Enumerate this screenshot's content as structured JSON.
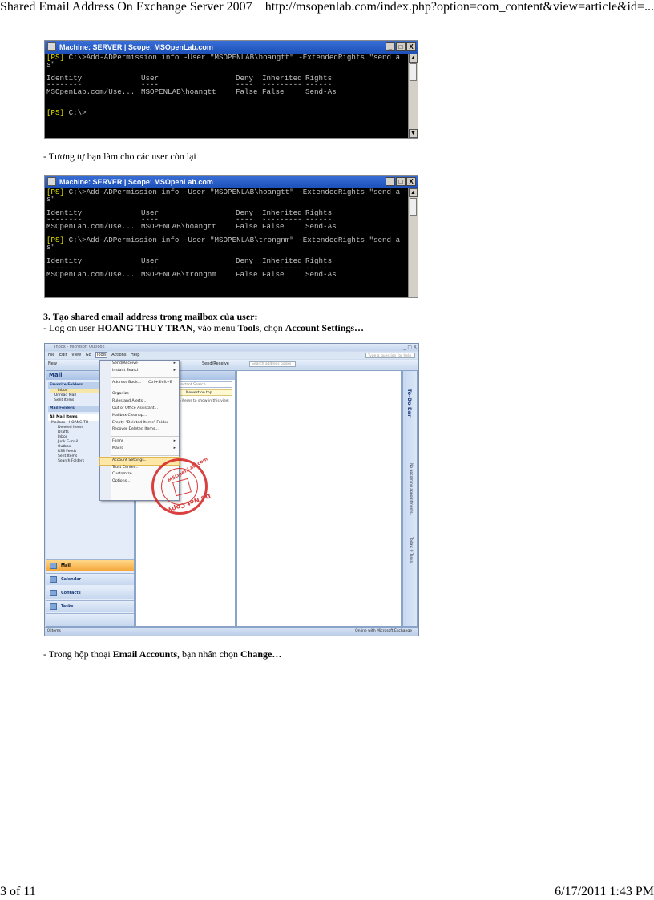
{
  "header": {
    "left": "Shared Email Address On Exchange Server 2007",
    "right": "http://msopenlab.com/index.php?option=com_content&view=article&id=..."
  },
  "footer": {
    "page": "3 of 11",
    "datetime": "6/17/2011 1:43 PM"
  },
  "console1": {
    "title": "Machine: SERVER | Scope: MSOpenLab.com",
    "buttons": [
      "_",
      "□",
      "X"
    ],
    "cmd_prompt": "[PS] ",
    "cmd_line1": "C:\\>Add-ADPermission info -User \"MSOPENLAB\\hoangtt\" -ExtendedRights \"send a",
    "cmd_line2": "s\"",
    "headers": [
      "Identity",
      "User",
      "Deny",
      "Inherited",
      "Rights"
    ],
    "underlines": [
      "--------",
      "----",
      "----",
      "---------",
      "------"
    ],
    "row": [
      "MSOpenLab.com/Use...",
      "MSOPENLAB\\hoangtt",
      "False",
      "False",
      "Send-As"
    ],
    "prompt2": "[PS] ",
    "prompt2_rest": "C:\\>_"
  },
  "para1": "- Tương tự bạn làm cho các user còn lại",
  "console2": {
    "title": "Machine: SERVER | Scope: MSOpenLab.com",
    "buttons": [
      "_",
      "□",
      "X"
    ],
    "cmd_prompt": "[PS] ",
    "cmd_line1": "C:\\>Add-ADPermission info -User \"MSOPENLAB\\hoangtt\" -ExtendedRights \"send a",
    "cmd_line2": "s\"",
    "headers": [
      "Identity",
      "User",
      "Deny",
      "Inherited",
      "Rights"
    ],
    "underlines": [
      "--------",
      "----",
      "----",
      "---------",
      "------"
    ],
    "row": [
      "MSOpenLab.com/Use...",
      "MSOPENLAB\\hoangtt",
      "False",
      "False",
      "Send-As"
    ],
    "cmd2_prompt": "[PS] ",
    "cmd2_line1": "C:\\>Add-ADPermission info -User \"MSOPENLAB\\trongnm\" -ExtendedRights \"send a",
    "cmd2_line2": "s\"",
    "row2": [
      "MSOpenLab.com/Use...",
      "MSOPENLAB\\trongnm",
      "False",
      "False",
      "Send-As"
    ]
  },
  "section3": {
    "heading": "3. Tạo shared email address trong mailbox của user:",
    "l_a": "- Log on user ",
    "l_b": "HOANG THUY TRAN",
    "l_c": ", vào menu ",
    "l_d": "Tools",
    "l_e": ", chọn ",
    "l_f": "Account Settings…"
  },
  "outlook": {
    "title": "Inbox - Microsoft Outlook",
    "window_buttons": "_ □ X",
    "menus": [
      "File",
      "Edit",
      "View",
      "Go",
      "Tools",
      "Actions",
      "Help"
    ],
    "help_box": "Type a question for help",
    "new_btn": "New",
    "send_receive": "Send/Receive",
    "address_box": "Search address books",
    "nav_header": "Mail",
    "fav_header": "Favorite Folders",
    "fav_items": [
      "Inbox",
      "Unread Mail",
      "Sent Items"
    ],
    "mail_folders": "Mail Folders",
    "all_mail": "All Mail Items",
    "tree": [
      "Mailbox - HOANG TH",
      "Deleted Items",
      "Drafts",
      "Inbox",
      "Junk E-mail",
      "Outbox",
      "RSS Feeds",
      "Sent Items",
      "Search Folders"
    ],
    "nav_buttons": [
      "Mail",
      "Calendar",
      "Contacts",
      "Tasks"
    ],
    "instant_search": "Instant Search",
    "arranged": "Newest on top",
    "no_items": "no items to show in this view.",
    "todo_bar": "To-Do Bar",
    "todo_appt": "No upcoming appointments.",
    "todo_tasks": "Today: 0 Tasks",
    "status_left": "0 Items",
    "status_right": "Online with Microsoft Exchange",
    "tools_menu": [
      {
        "label": "Send/Receive",
        "arrow": "▸"
      },
      {
        "label": "Instant Search",
        "arrow": "▸"
      },
      {
        "label": "Address Book...",
        "shortcut": "Ctrl+Shift+B"
      },
      {
        "label": "Organize"
      },
      {
        "label": "Rules and Alerts..."
      },
      {
        "label": "Out of Office Assistant..."
      },
      {
        "label": "Mailbox Cleanup..."
      },
      {
        "label": "Empty \"Deleted Items\" Folder"
      },
      {
        "label": "Recover Deleted Items..."
      },
      {
        "label": "Forms",
        "arrow": "▸"
      },
      {
        "label": "Macro",
        "arrow": "▸"
      },
      {
        "label": "Account Settings..."
      },
      {
        "label": "Trust Center..."
      },
      {
        "label": "Customize..."
      },
      {
        "label": "Options..."
      }
    ],
    "stamp_top": "MSOpenLab.com",
    "stamp_bottom": "Do Not Copy"
  },
  "para_last": {
    "a": "- Trong hộp thoại ",
    "b": "Email Accounts",
    "c": ", bạn nhấn chọn ",
    "d": "Change…"
  }
}
